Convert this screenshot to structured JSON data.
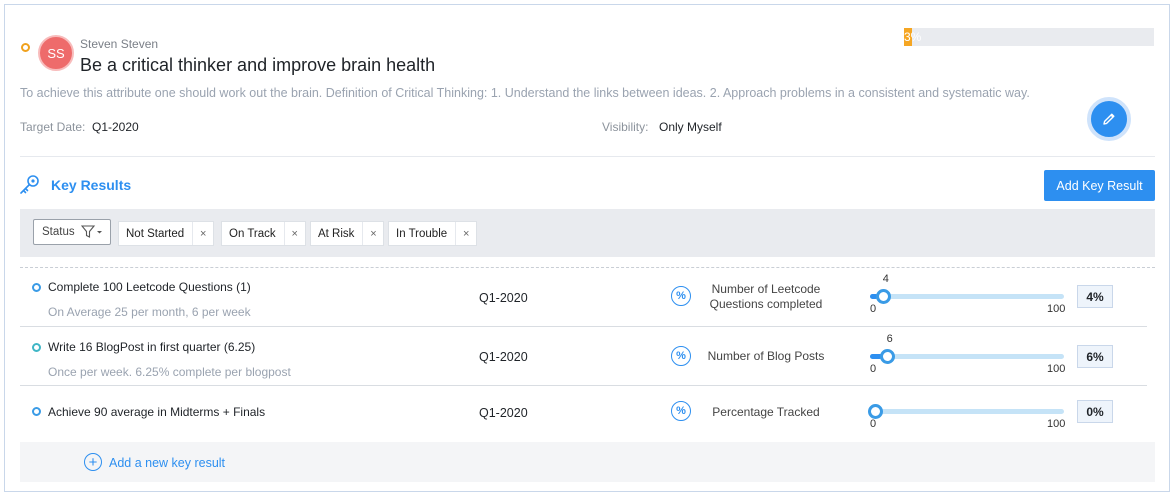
{
  "objective": {
    "owner_initials": "SS",
    "owner_name": "Steven Steven",
    "title": "Be a critical thinker and improve brain health",
    "progress_percent": 3,
    "progress_text": "3%",
    "description": "To achieve this attribute one should work out the brain. Definition of Critical Thinking: 1. Understand the links between ideas. 2. Approach problems in a consistent and systematic way.",
    "target_date_label": "Target Date:",
    "target_date_value": "Q1-2020",
    "visibility_label": "Visibility:",
    "visibility_value": "Only Myself"
  },
  "key_results_section": {
    "heading": "Key Results",
    "add_button": "Add Key Result",
    "filter": {
      "status_label": "Status",
      "tags": [
        "Not Started",
        "On Track",
        "At Risk",
        "In Trouble"
      ],
      "remove_glyph": "×"
    },
    "items": [
      {
        "name": "Complete 100 Leetcode Questions (1)",
        "subtitle": "On Average 25 per month, 6 per week",
        "date": "Q1-2020",
        "metric": "Number of Leetcode Questions completed",
        "value": "4",
        "min": "0",
        "max": "100",
        "percent": "4%"
      },
      {
        "name": "Write 16 BlogPost in first quarter (6.25)",
        "subtitle": "Once per week. 6.25% complete per blogpost",
        "date": "Q1-2020",
        "metric": "Number of Blog Posts",
        "value": "6",
        "min": "0",
        "max": "100",
        "percent": "6%"
      },
      {
        "name": "Achieve 90 average in Midterms + Finals",
        "subtitle": "",
        "date": "Q1-2020",
        "metric": "Percentage Tracked",
        "value": "",
        "min": "0",
        "max": "100",
        "percent": "0%"
      }
    ],
    "add_new_label": "Add a new key result"
  },
  "colors": {
    "accent": "#2d8ff0",
    "progress": "#f5a623",
    "avatar": "#ee6b6b",
    "status_dot_objective": "#f0a11d",
    "status_dot_on_track": "#3a9be6",
    "status_dot_teal": "#3fb6c6"
  },
  "icons": [
    "key-icon",
    "pencil-icon",
    "filter-icon",
    "percent-icon",
    "plus-circle-icon"
  ]
}
